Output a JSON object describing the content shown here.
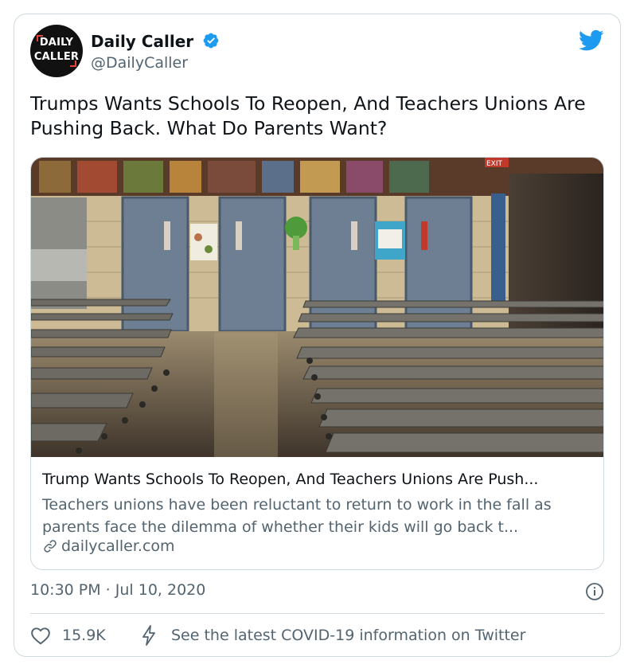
{
  "author": {
    "name": "Daily Caller",
    "handle": "@DailyCaller",
    "avatar_text_line1": "DAILY",
    "avatar_text_line2": "CALLER"
  },
  "tweet": {
    "text": "Trumps Wants Schools To Reopen, And Teachers Unions Are Pushing Back. What Do Parents Want?"
  },
  "link_card": {
    "title": "Trump Wants Schools To Reopen, And Teachers Unions Are Push...",
    "description": "Teachers unions have been reluctant to return to work in the fall as parents face the dilemma of whether their kids will go back t...",
    "domain": "dailycaller.com",
    "image_sign_text": "EXIT"
  },
  "meta": {
    "timestamp": "10:30 PM · Jul 10, 2020"
  },
  "actions": {
    "like_count": "15.9K",
    "covid_label": "See the latest COVID-19 information on Twitter"
  },
  "icons": {
    "verified": "verified-badge-icon",
    "bird": "twitter-bird-icon",
    "link": "link-icon",
    "info": "info-icon",
    "heart": "heart-icon",
    "bolt": "bolt-icon"
  },
  "colors": {
    "twitter_blue": "#1d9bf0",
    "text_primary": "#0f1419",
    "text_secondary": "#536471",
    "border": "#cfd9de",
    "logo_red": "#e8433a"
  }
}
